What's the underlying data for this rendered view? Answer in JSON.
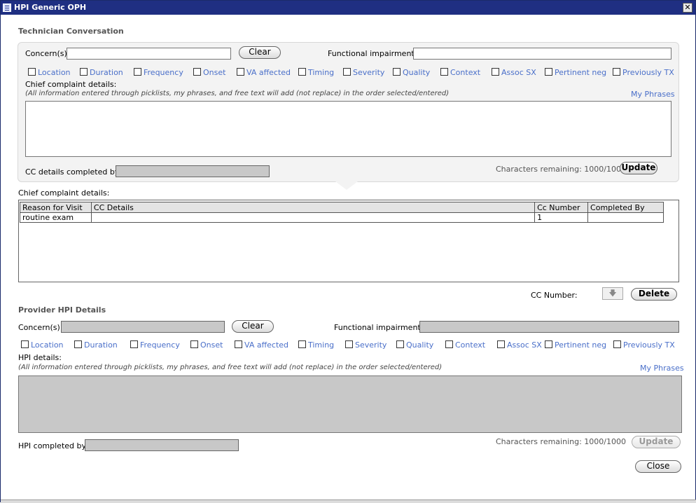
{
  "window": {
    "title": "HPI Generic OPH",
    "close_glyph": "✕"
  },
  "technician": {
    "section_title": "Technician Conversation",
    "concerns_label": "Concern(s):",
    "concerns_value": "",
    "clear_label": "Clear",
    "functional_label": "Functional impairment:",
    "functional_value": "",
    "checkboxes": [
      "Location",
      "Duration",
      "Frequency",
      "Onset",
      "VA affected",
      "Timing",
      "Severity",
      "Quality",
      "Context",
      "Assoc SX",
      "Pertinent neg",
      "Previously TX"
    ],
    "details_label": "Chief complaint details:",
    "details_note": "(All information entered through picklists, my phrases, and free text will add (not replace) in the order selected/entered)",
    "my_phrases": "My Phrases",
    "completed_by_label": "CC details completed by:",
    "chars_remaining": "Characters remaining: 1000/1000",
    "update_label": "Update"
  },
  "cc_grid": {
    "title": "Chief complaint details:",
    "columns": [
      "Reason for Visit",
      "CC Details",
      "Cc Number",
      "Completed By"
    ],
    "rows": [
      [
        "routine exam",
        "",
        "1",
        ""
      ]
    ],
    "cc_number_label": "CC Number:",
    "move_down_glyph": "🡇",
    "delete_label": "Delete"
  },
  "provider": {
    "section_title": "Provider HPI Details",
    "concerns_label": "Concern(s):",
    "clear_label": "Clear",
    "functional_label": "Functional impairment:",
    "checkboxes": [
      "Location",
      "Duration",
      "Frequency",
      "Onset",
      "VA affected",
      "Timing",
      "Severity",
      "Quality",
      "Context",
      "Assoc SX",
      "Pertinent neg",
      "Previously TX"
    ],
    "details_label": "HPI details:",
    "details_note": "(All information entered through picklists, my phrases, and free text will add (not replace) in the order selected/entered)",
    "my_phrases": "My Phrases",
    "completed_by_label": "HPI completed by:",
    "chars_remaining": "Characters remaining: 1000/1000",
    "update_label": "Update"
  },
  "footer": {
    "close_label": "Close"
  },
  "colors": {
    "titlebar": "#1f2f82",
    "link": "#4a6fc9",
    "disabled_field": "#c8c8c8",
    "panel": "#f3f3f3"
  }
}
